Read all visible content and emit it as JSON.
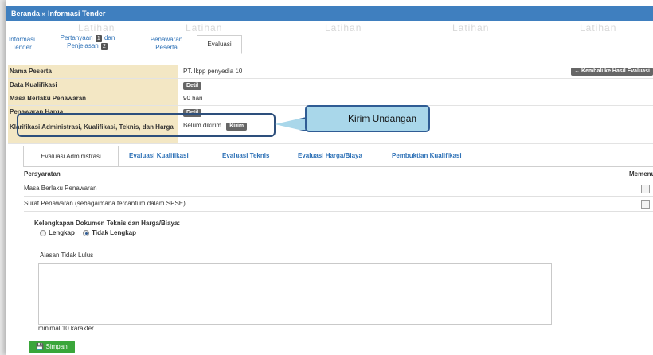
{
  "breadcrumb": "Beranda » Informasi Tender",
  "watermark": "Latihan",
  "tabs": [
    {
      "line1": "Informasi",
      "line2": "Tender",
      "badge": ""
    },
    {
      "line1": "Pertanyaan",
      "badge1": "1",
      "line1b": "dan",
      "line2": "Penjelasan",
      "badge2": "2"
    },
    {
      "line1": "Penawaran",
      "line2": "Peserta"
    },
    {
      "label": "Evaluasi"
    }
  ],
  "info": {
    "nama_peserta_label": "Nama Peserta",
    "nama_peserta_value": "PT. lkpp penyedia 10",
    "kembali_label": "← Kembali ke Hasil Evaluasi",
    "data_kualifikasi_label": "Data Kualifikasi",
    "detil_label": "Detil",
    "masa_berlaku_label": "Masa Berlaku Penawaran",
    "masa_berlaku_value": "90 hari",
    "penawaran_harga_label": "Penawaran Harga",
    "klarifikasi_label": "Klarifikasi Administrasi, Kualifikasi, Teknis, dan Harga",
    "klarifikasi_status": "Belum dikirim",
    "kirim_label": "Kirim"
  },
  "callout": "Kirim Undangan",
  "eval_tabs": [
    "Evaluasi Administrasi",
    "Evaluasi Kualifikasi",
    "Evaluasi Teknis",
    "Evaluasi Harga/Biaya",
    "Pembuktian Kualifikasi"
  ],
  "requirements": {
    "header": "Persyaratan",
    "header_right": "Memenuhi",
    "rows": [
      "Masa Berlaku Penawaran",
      "Surat Penawaran (sebagaimana tercantum dalam SPSE)"
    ]
  },
  "kelengkapan": {
    "label": "Kelengkapan Dokumen Teknis dan Harga/Biaya:",
    "option1": "Lengkap",
    "option2": "Tidak Lengkap",
    "selected": "Tidak Lengkap"
  },
  "alasan_label": "Alasan Tidak Lulus",
  "minimal_text": "minimal 10 karakter",
  "simpan_label": "Simpan",
  "colors": {
    "header_bar": "#3f7fbf",
    "label_bg": "#f3e7c4",
    "save_button": "#3aa63a",
    "callout_fill": "#a9d7ea"
  }
}
